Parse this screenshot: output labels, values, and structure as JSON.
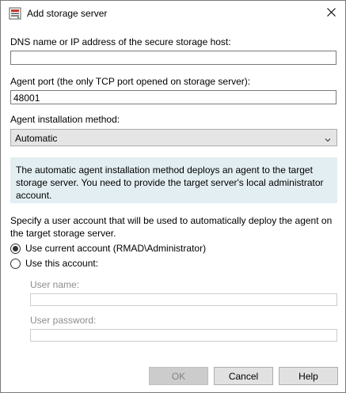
{
  "window": {
    "title": "Add storage server",
    "icon": "storage-server-icon",
    "close_icon": "close-icon"
  },
  "form": {
    "dns_label": "DNS name or IP address of the secure storage host:",
    "dns_value": "",
    "port_label": "Agent port (the only TCP port opened on storage server):",
    "port_value": "48001",
    "method_label": "Agent installation method:",
    "method_value": "Automatic",
    "info_text": "The automatic agent installation method deploys an agent to the target storage server. You need to provide the target server's local administrator account.",
    "account_description": "Specify a user account that will be used to automatically deploy the agent on the target storage server.",
    "radio_current": "Use current account (RMAD\\Administrator)",
    "radio_current_checked": true,
    "radio_this": "Use this account:",
    "radio_this_checked": false,
    "username_label": "User name:",
    "username_value": "",
    "password_label": "User password:",
    "password_value": ""
  },
  "buttons": {
    "ok": "OK",
    "cancel": "Cancel",
    "help": "Help"
  },
  "colors": {
    "info_background": "#e3eef2",
    "disabled_text": "#8c8c8c",
    "focus_border": "#0078d7"
  }
}
